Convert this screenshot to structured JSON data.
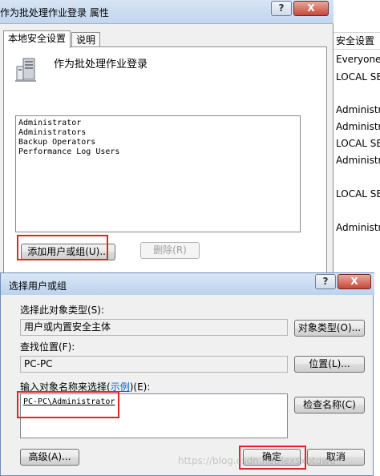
{
  "bg_window": {
    "title": "作为批处理作业登录 属性",
    "controls": {
      "help": "?",
      "close": "X"
    },
    "tabs": [
      {
        "label": "本地安全设置"
      },
      {
        "label": "说明"
      }
    ],
    "policy_name": "作为批处理作业登录",
    "members": [
      "Administrator",
      "Administrators",
      "Backup Operators",
      "Performance Log Users"
    ],
    "add_button": "添加用户或组(U)...",
    "remove_button": "删除(R)"
  },
  "right_strip": {
    "header": "安全设置",
    "cells": [
      "Everyone,",
      "LOCAL SE",
      "Administra",
      "Administra",
      "LOCAL SE",
      "Administra",
      "LOCAL SE",
      "Administra"
    ]
  },
  "dialog": {
    "title": "选择用户或组",
    "controls": {
      "help": "?",
      "close": "X"
    },
    "object_type_label": "选择此对象类型(S):",
    "object_type_value": "用户或内置安全主体",
    "object_type_button": "对象类型(O)...",
    "location_label": "查找位置(F):",
    "location_value": "PC-PC",
    "location_button": "位置(L)...",
    "names_label_prefix": "输入对象名称来选择(",
    "names_label_link": "示例",
    "names_label_suffix": ")(E):",
    "names_value": "PC-PC\\Administrator",
    "check_names_button": "检查名称(C)",
    "advanced_button": "高级(A)...",
    "ok_button": "确定",
    "cancel_button": "取消"
  },
  "watermark": "https://blog.csdn.net/lexsxbtgw0",
  "colors": {
    "highlight_box": "#e8202e",
    "link": "#0066cc"
  }
}
